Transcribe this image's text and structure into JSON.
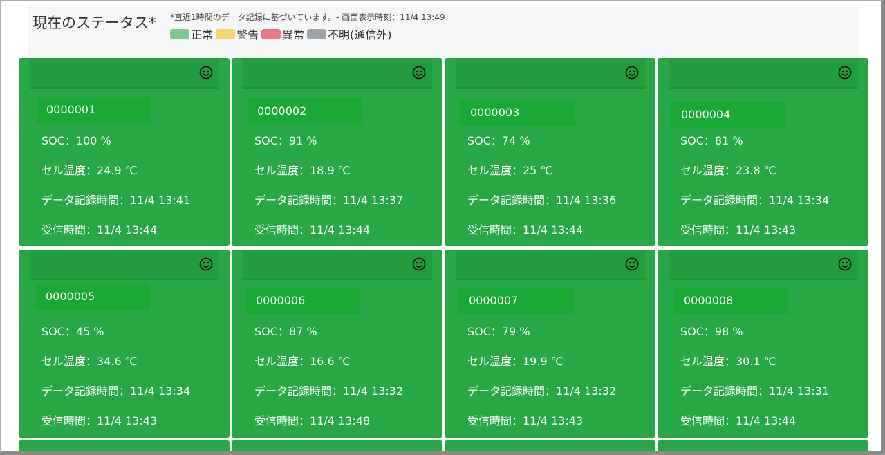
{
  "header": {
    "title": "現在のステータス*",
    "note": "*直近1時間のデータ記録に基づいています。- 画面表示時刻：11/4 13:49",
    "legend": [
      {
        "label": "正常",
        "color": "#7cc98a"
      },
      {
        "label": "警告",
        "color": "#f5d56a"
      },
      {
        "label": "異常",
        "color": "#e97a85"
      },
      {
        "label": "不明(通信外)",
        "color": "#9ea3a8"
      }
    ]
  },
  "colors": {
    "card_bg": "#28a745",
    "card_text": "#ffffff"
  },
  "status_icon": "smiley-face-icon",
  "cards": [
    {
      "id": "0000001",
      "soc": "SOC：100 %",
      "temp": "セル温度：24.9 ℃",
      "record": "データ記録時間：11/4 13:41",
      "recv": "受信時間：11/4 13:44"
    },
    {
      "id": "0000002",
      "soc": "SOC：91 %",
      "temp": "セル温度：18.9 ℃",
      "record": "データ記録時間：11/4 13:37",
      "recv": "受信時間：11/4 13:44"
    },
    {
      "id": "0000003",
      "soc": "SOC：74 %",
      "temp": "セル温度：25 ℃",
      "record": "データ記録時間：11/4 13:36",
      "recv": "受信時間：11/4 13:44"
    },
    {
      "id": "0000004",
      "soc": "SOC：81 %",
      "temp": "セル温度：23.8 ℃",
      "record": "データ記録時間：11/4 13:34",
      "recv": "受信時間：11/4 13:43"
    },
    {
      "id": "0000005",
      "soc": "SOC：45 %",
      "temp": "セル温度：34.6 ℃",
      "record": "データ記録時間：11/4 13:34",
      "recv": "受信時間：11/4 13:43"
    },
    {
      "id": "0000006",
      "soc": "SOC：87 %",
      "temp": "セル温度：16.6 ℃",
      "record": "データ記録時間：11/4 13:32",
      "recv": "受信時間：11/4 13:48"
    },
    {
      "id": "0000007",
      "soc": "SOC：79 %",
      "temp": "セル温度：19.9 ℃",
      "record": "データ記録時間：11/4 13:32",
      "recv": "受信時間：11/4 13:43"
    },
    {
      "id": "0000008",
      "soc": "SOC：98 %",
      "temp": "セル温度：30.1 ℃",
      "record": "データ記録時間：11/4 13:31",
      "recv": "受信時間：11/4 13:44"
    }
  ]
}
